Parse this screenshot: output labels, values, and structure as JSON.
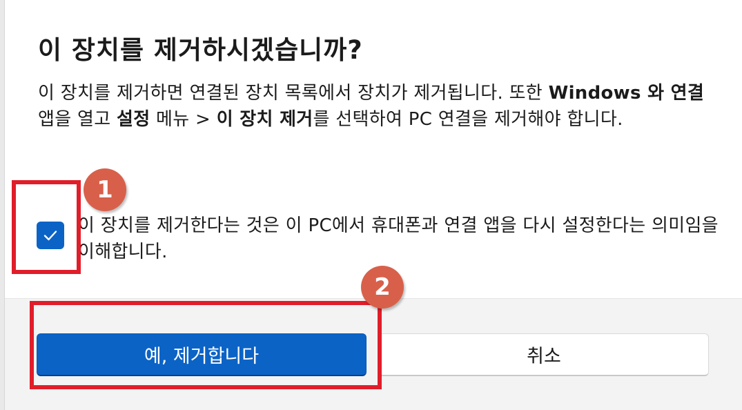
{
  "dialog": {
    "title": "이 장치를 제거하시겠습니까?",
    "description": {
      "p1": "이 장치를 제거하면 연결된 장치 목록에서 장치가 제거됩니다. 또한 ",
      "b1": "Windows 와 연결",
      "p2": " 앱을 열고 ",
      "b2": "설정",
      "p3": " 메뉴 > ",
      "b3": "이 장치 제거",
      "p4": "를 선택하여 PC 연결을 제거해야 합니다."
    },
    "checkbox": {
      "checked": true,
      "label": "이 장치를 제거한다는 것은 이 PC에서 휴대폰과 연결 앱을 다시 설정한다는 의미임을 이해합니다."
    },
    "buttons": {
      "confirm": "예, 제거합니다",
      "cancel": "취소"
    }
  },
  "annotations": {
    "step1": "1",
    "step2": "2"
  },
  "colors": {
    "accent": "#0b63c6",
    "annotation_box": "#e11d2a",
    "badge": "#d8604a"
  }
}
